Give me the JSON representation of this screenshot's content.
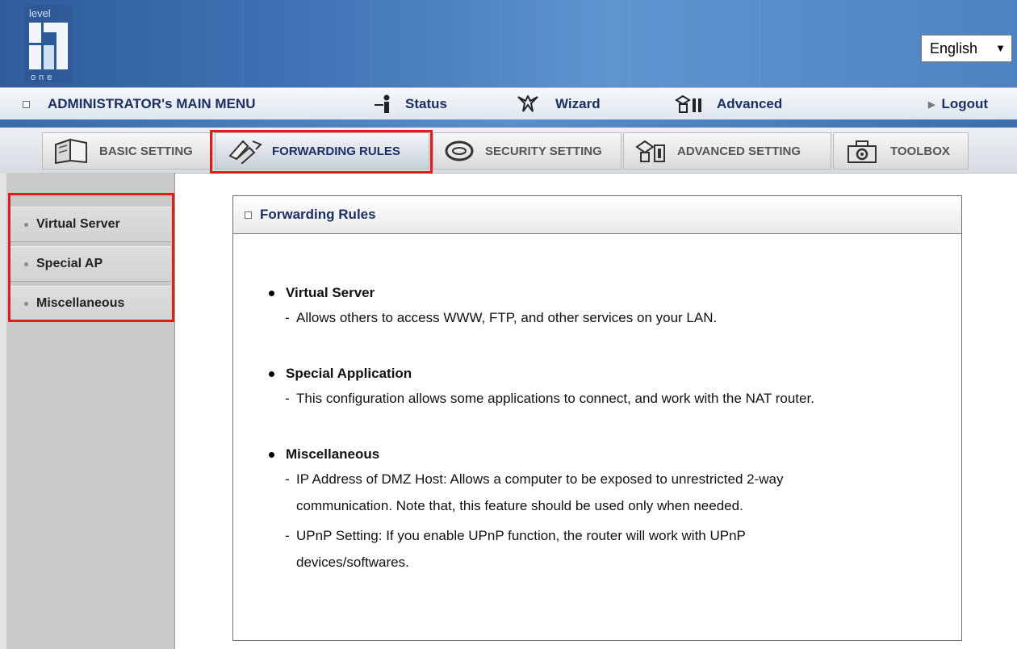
{
  "header": {
    "brand_top": "level",
    "brand_bottom": "one",
    "language": "English"
  },
  "menubar": {
    "admin_label": "ADMINISTRATOR's MAIN MENU",
    "status_label": "Status",
    "wizard_label": "Wizard",
    "advanced_label": "Advanced",
    "logout_label": "Logout"
  },
  "tabs": [
    {
      "label": "BASIC SETTING",
      "icon": "book-icon"
    },
    {
      "label": "FORWARDING RULES",
      "icon": "arrow-pages-icon",
      "active": true
    },
    {
      "label": "SECURITY SETTING",
      "icon": "ring-icon"
    },
    {
      "label": "ADVANCED SETTING",
      "icon": "building-icon"
    },
    {
      "label": "TOOLBOX",
      "icon": "toolbox-icon"
    }
  ],
  "sidebar": {
    "items": [
      {
        "label": "Virtual Server"
      },
      {
        "label": "Special AP"
      },
      {
        "label": "Miscellaneous"
      }
    ]
  },
  "panel": {
    "title": "Forwarding Rules",
    "sections": [
      {
        "title": "Virtual Server",
        "lines": [
          "Allows others to access WWW, FTP, and other services on your LAN."
        ]
      },
      {
        "title": "Special Application",
        "lines": [
          "This configuration allows some applications to connect, and work with the NAT router."
        ]
      },
      {
        "title": "Miscellaneous",
        "lines": [
          "IP Address of DMZ Host: Allows a computer to be exposed to unrestricted 2-way",
          "communication. Note that, this feature should be used only when needed.",
          "UPnP Setting: If you enable UPnP function, the router will work with UPnP",
          "devices/softwares."
        ]
      }
    ]
  },
  "colors": {
    "highlight": "#e21b1b",
    "menu_text": "#1c2f63"
  }
}
